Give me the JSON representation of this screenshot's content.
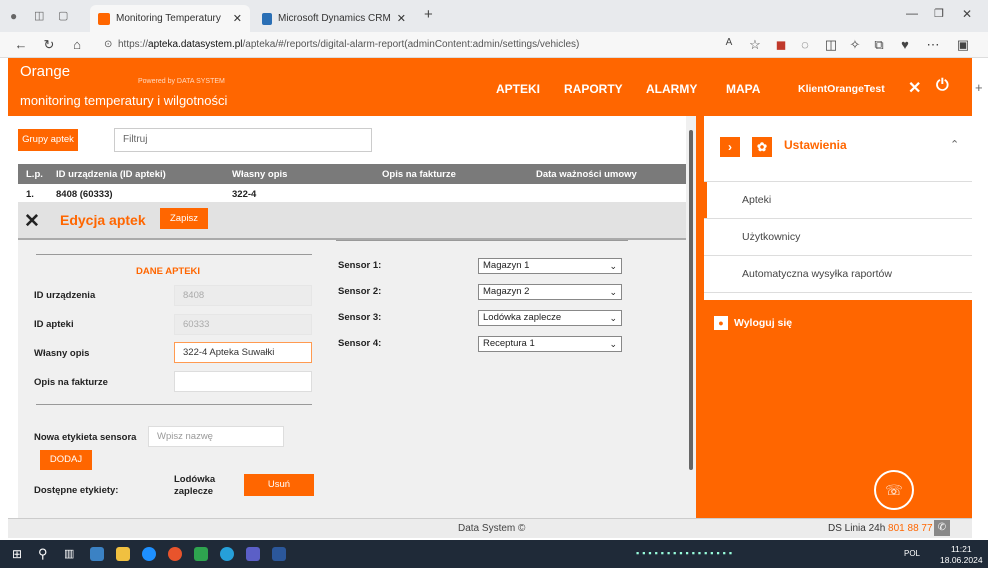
{
  "browser": {
    "tabs": [
      {
        "label": "Monitoring Temperatury",
        "active": true
      },
      {
        "label": "Microsoft Dynamics CRM",
        "active": false
      }
    ],
    "url_prefix": "https://",
    "url_host": "apteka.datasystem.pl",
    "url_path": "/apteka/#/reports/digital-alarm-report(adminContent:admin/settings/vehicles)"
  },
  "header": {
    "brand": "Orange",
    "powered": "Powered by DATA SYSTEM",
    "subtitle": "monitoring temperatury i wilgotności",
    "nav": [
      "APTEKI",
      "RAPORTY",
      "ALARMY",
      "MAPA"
    ],
    "user": "KlientOrangeTest",
    "accent": "#ff6600"
  },
  "main": {
    "grupy_label": "Grupy aptek",
    "filter_placeholder": "Filtruj",
    "table": {
      "headers": [
        "L.p.",
        "ID urządzenia (ID apteki)",
        "Własny opis",
        "Opis na fakturze",
        "Data ważności umowy"
      ],
      "rows": [
        [
          "1.",
          "8408 (60333)",
          "322-4",
          "",
          ""
        ]
      ]
    },
    "edit": {
      "title": "Edycja aptek",
      "save_label": "Zapisz"
    },
    "form": {
      "section_title": "DANE APTEKI",
      "id_urzadzenia_label": "ID urządzenia",
      "id_urzadzenia_value": "8408",
      "id_apteki_label": "ID apteki",
      "id_apteki_value": "60333",
      "wlasny_opis_label": "Własny opis",
      "wlasny_opis_value": "322-4 Apteka Suwałki",
      "opis_faktura_label": "Opis na fakturze",
      "opis_faktura_value": "",
      "sensors": [
        {
          "label": "Sensor 1:",
          "value": "Magazyn 1"
        },
        {
          "label": "Sensor 2:",
          "value": "Magazyn 2"
        },
        {
          "label": "Sensor 3:",
          "value": "Lodówka zaplecze"
        },
        {
          "label": "Sensor 4:",
          "value": "Receptura 1"
        }
      ],
      "nowa_label": "Nowa etykieta sensora",
      "nowa_placeholder": "Wpisz nazwę",
      "dodaj_label": "DODAJ",
      "dostepne_label": "Dostępne etykiety:",
      "etykieta": "Lodówka zaplecze",
      "usun_label": "Usuń"
    }
  },
  "settings": {
    "title": "Ustawienia",
    "items": [
      "Apteki",
      "Użytkownicy",
      "Automatyczna wysyłka raportów"
    ],
    "active_item": "Apteki",
    "logout": "Wyloguj się"
  },
  "footer": {
    "text": "Data System ©",
    "hotline_label": "DS Linia 24h",
    "hotline_number": "801 88 77 88"
  },
  "taskbar": {
    "lang": "POL",
    "time": "11:21",
    "date": "18.06.2024"
  }
}
